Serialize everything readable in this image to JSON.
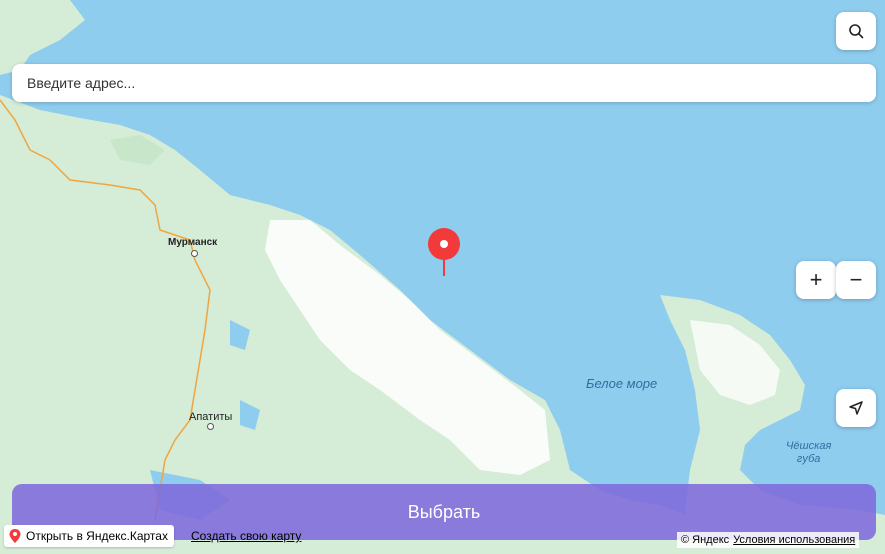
{
  "search": {
    "placeholder": "Введите адрес..."
  },
  "map": {
    "labels": {
      "murmansk": "Мурманск",
      "apatity": "Апатиты",
      "white_sea": "Белое море",
      "bay_line1": "Чёшская",
      "bay_line2": "губа"
    },
    "colors": {
      "water": "#8fcdef",
      "land": "#d5ecd6",
      "snow": "#ffffff",
      "marker": "#f23a3a",
      "road": "#f0a640"
    }
  },
  "controls": {
    "zoom_in": "+",
    "zoom_out": "−"
  },
  "actions": {
    "select": "Выбрать"
  },
  "footer": {
    "open_yandex": "Открыть в Яндекс.Картах",
    "create_map": "Создать свою карту",
    "copyright": "© Яндекс",
    "terms": "Условия использования"
  },
  "icons": [
    "search-icon",
    "location-arrow-icon",
    "map-pin-icon",
    "yandex-maps-pin-icon"
  ]
}
